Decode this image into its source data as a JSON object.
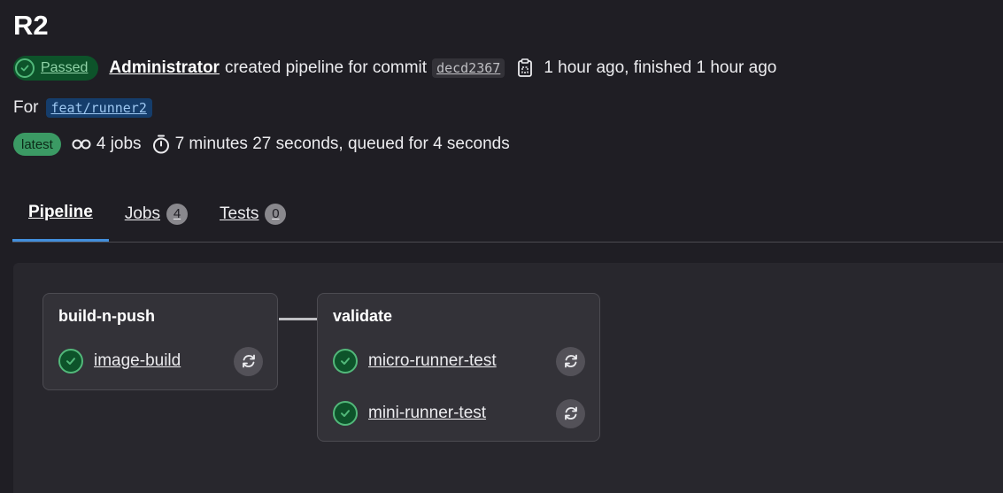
{
  "pipeline": {
    "title": "R2",
    "status_label": "Passed",
    "author": "Administrator",
    "action_text": "created pipeline for commit",
    "commit_sha": "decd2367",
    "timing_text": "1 hour ago, finished 1 hour ago",
    "for_label": "For",
    "ref": "feat/runner2",
    "latest_badge": "latest",
    "jobs_count_text": "4 jobs",
    "duration_text": "7 minutes 27 seconds, queued for 4 seconds"
  },
  "tabs": [
    {
      "label": "Pipeline",
      "active": true
    },
    {
      "label": "Jobs",
      "count": "4"
    },
    {
      "label": "Tests",
      "count": "0"
    }
  ],
  "stages": [
    {
      "name": "build-n-push",
      "jobs": [
        {
          "name": "image-build",
          "status_icon": "check-circle-icon",
          "action_icon": "retry-icon"
        }
      ]
    },
    {
      "name": "validate",
      "jobs": [
        {
          "name": "micro-runner-test",
          "status_icon": "check-circle-icon",
          "action_icon": "retry-icon"
        },
        {
          "name": "mini-runner-test",
          "status_icon": "check-circle-icon",
          "action_icon": "retry-icon"
        }
      ]
    }
  ],
  "colors": {
    "background": "#1f1e24",
    "success": "#52b87a",
    "success_bg": "#0d532a",
    "accent": "#428fdc",
    "graph_background": "#28272d"
  }
}
